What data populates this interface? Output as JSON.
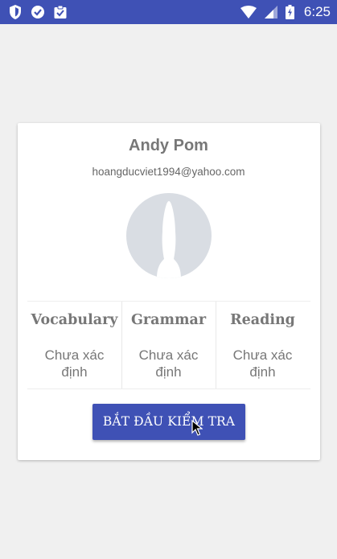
{
  "status_bar": {
    "time": "6:25",
    "left_icons": [
      "shield-icon",
      "heart-icon",
      "clipboard-check-icon"
    ],
    "right_icons": [
      "wifi-icon",
      "signal-icon",
      "battery-charging-icon"
    ]
  },
  "profile": {
    "name": "Andy Pom",
    "email": "hoangducviet1994@yahoo.com",
    "avatar_icon": "person-silhouette-icon"
  },
  "skills": [
    {
      "title": "Vocabulary",
      "status": "Chưa xác định"
    },
    {
      "title": "Grammar",
      "status": "Chưa xác định"
    },
    {
      "title": "Reading",
      "status": "Chưa xác định"
    }
  ],
  "start_button_label": "BẮT ĐẦU KIỂM TRA",
  "colors": {
    "primary": "#3f51b5",
    "background": "#f0f0f0",
    "card": "#ffffff",
    "text_gray": "#777777",
    "avatar_bg": "#d9dde3"
  }
}
